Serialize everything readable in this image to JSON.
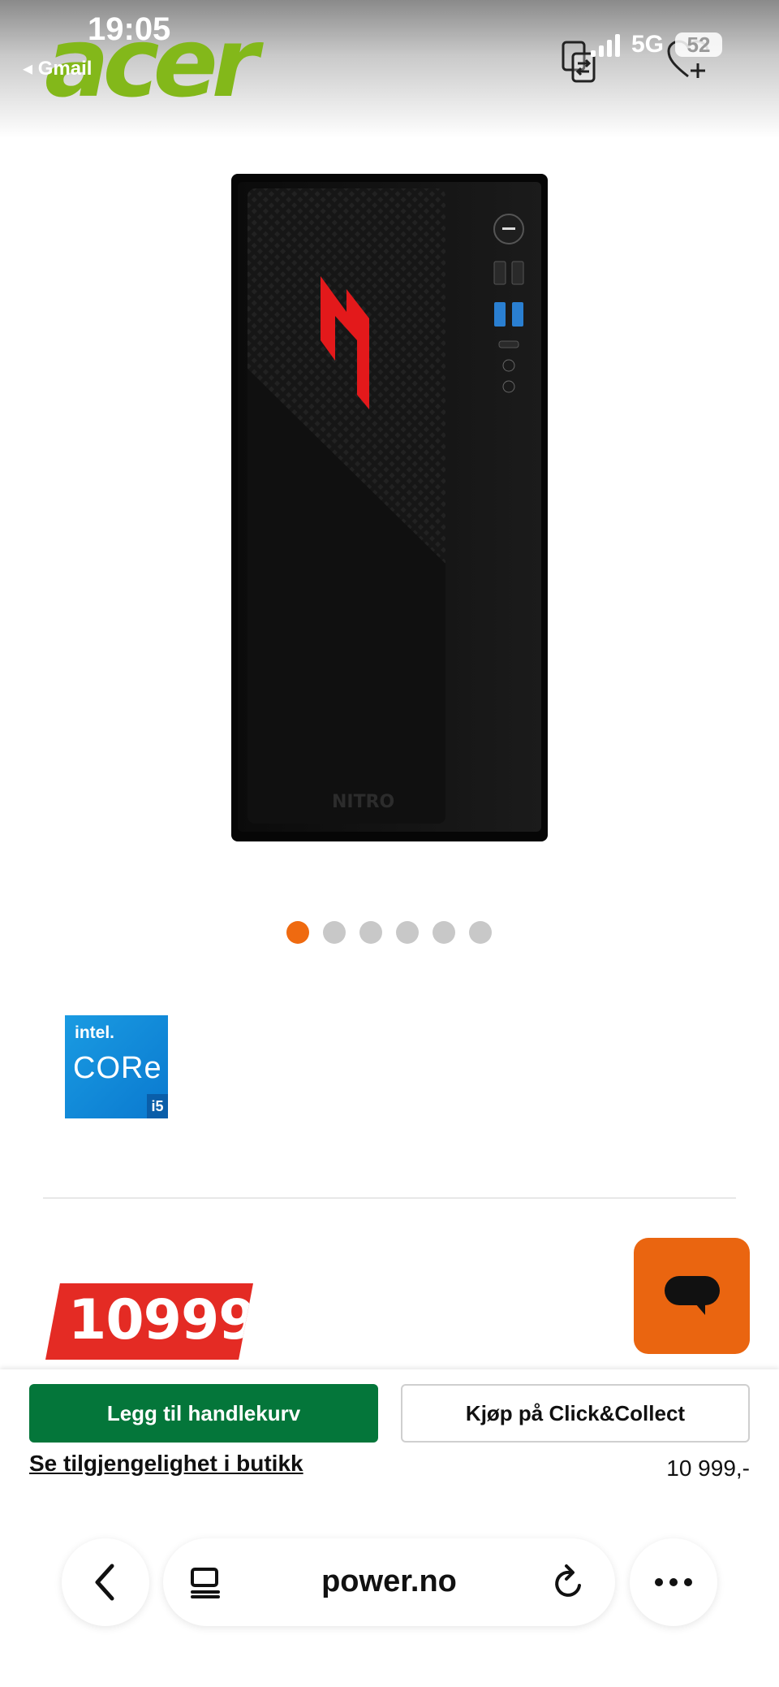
{
  "status_bar": {
    "time": "19:05",
    "back_app": "◂ Gmail",
    "network": "5G",
    "battery": "52"
  },
  "header": {
    "brand_logo": "acer",
    "icons": [
      "compare-icon",
      "wishlist-heart-icon"
    ]
  },
  "gallery": {
    "total_slides": 6,
    "active_slide": 1
  },
  "badge": {
    "brand": "intel.",
    "line": "CORe",
    "tier": "i5"
  },
  "price": {
    "main": "10999",
    "secondary": "10 999,-"
  },
  "buy_bar": {
    "add_to_cart": "Legg til handlekurv",
    "click_collect": "Kjøp på Click&Collect",
    "store_availability": "Se tilgjengelighet i butikk"
  },
  "browser": {
    "url": "power.no",
    "icons": [
      "back-chevron-icon",
      "reader-icon",
      "reload-icon",
      "more-icon"
    ]
  },
  "colors": {
    "accent_orange": "#ef6a10",
    "price_red": "#e42b24",
    "cart_green": "#04763a",
    "acer_green": "#83b81a",
    "intel_blue": "#0a79cf"
  }
}
